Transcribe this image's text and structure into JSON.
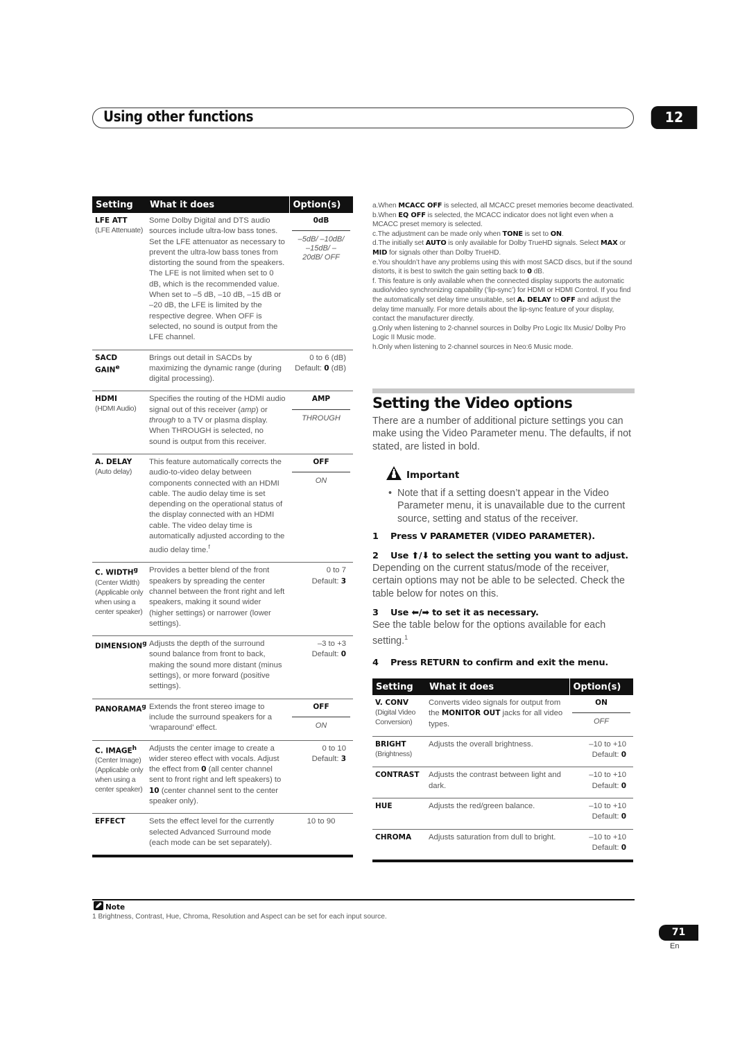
{
  "header": {
    "title": "Using other functions",
    "chapter": "12"
  },
  "audio_table": {
    "columns": [
      "Setting",
      "What it does",
      "Option(s)"
    ],
    "rows": [
      {
        "name": "LFE ATT",
        "sup": "",
        "sub": "(LFE Attenuate)",
        "desc": "Some Dolby Digital and DTS audio sources include ultra-low bass tones. Set the LFE attenuator as necessary to prevent the ultra-low bass tones from distorting the sound from the speakers. The LFE is not limited when set to 0 dB, which is the recommended value. When set to –5 dB, –10 dB, –15 dB or –20 dB, the LFE is limited by the respective degree. When OFF is selected, no sound is output from the LFE channel.",
        "opt_default": "0dB",
        "opt_alt": "–5dB/ –10dB/ –15dB/ –20dB/ OFF"
      },
      {
        "name": "SACD GAIN",
        "sup": "e",
        "sub": "",
        "desc": "Brings out detail in SACDs by maximizing the dynamic range (during digital processing).",
        "range": "0 to 6 (dB)",
        "default_prefix": "Default: ",
        "default_value": "0",
        "default_suffix": " (dB)"
      },
      {
        "name": "HDMI",
        "sup": "",
        "sub": "(HDMI Audio)",
        "desc_parts": [
          "Specifies the routing of the HDMI audio signal out of this receiver (",
          "amp",
          ") or ",
          "through",
          " to a TV or plasma display. When THROUGH is selected, no sound is output from this receiver."
        ],
        "opt_default": "AMP",
        "opt_alt": "THROUGH"
      },
      {
        "name": "A. DELAY",
        "sup": "",
        "sub": "(Auto delay)",
        "desc": "This feature automatically corrects the audio-to-video delay between components connected with an HDMI cable. The audio delay time is set depending on the operational status of the display connected with an HDMI cable. The video delay time is automatically adjusted according to the audio delay time.",
        "desc_sup": "f",
        "opt_default": "OFF",
        "opt_alt": "ON"
      },
      {
        "name": "C. WIDTH",
        "sup": "g",
        "sub": "(Center Width) (Applicable only when using a center speaker)",
        "desc": "Provides a better blend of the front speakers by spreading the center channel between the front right and left speakers, making it sound wider (higher settings) or narrower (lower settings).",
        "range": "0 to 7",
        "default_prefix": "Default: ",
        "default_value": "3",
        "default_suffix": ""
      },
      {
        "name": "DIMENSION",
        "sup": "g",
        "sub": "",
        "desc": "Adjusts the depth of the surround sound balance from front to back, making the sound more distant (minus settings), or more forward (positive settings).",
        "range": "–3 to +3",
        "default_prefix": "Default: ",
        "default_value": "0",
        "default_suffix": ""
      },
      {
        "name": "PANORAMA",
        "sup": "g",
        "sub": "",
        "desc": "Extends the front stereo image to include the surround speakers for a ‘wraparound’ effect.",
        "opt_default": "OFF",
        "opt_alt": "ON"
      },
      {
        "name": "C. IMAGE",
        "sup": "h",
        "sub": "(Center Image) (Applicable only when using a center speaker)",
        "desc_parts": [
          "Adjusts the center image to create a wider stereo effect with vocals. Adjust the effect from ",
          "0",
          " (all center channel sent to front right and left speakers) to ",
          "10",
          " (center channel sent to the center speaker only)."
        ],
        "range": "0 to 10",
        "default_prefix": "Default: ",
        "default_value": "3",
        "default_suffix": ""
      },
      {
        "name": "EFFECT",
        "sup": "",
        "sub": "",
        "desc": "Sets the effect level for the currently selected Advanced Surround mode (each mode can be set separately).",
        "range": "10 to 90"
      }
    ]
  },
  "footnotes": [
    {
      "parts": [
        "a.When ",
        "MCACC OFF",
        " is selected, all MCACC preset memories become deactivated."
      ]
    },
    {
      "parts": [
        "b.When ",
        "EQ OFF",
        " is selected, the MCACC indicator does not light even when a MCACC preset memory is selected."
      ]
    },
    {
      "parts": [
        "c.The adjustment can be made only when ",
        "TONE",
        " is set to ",
        "ON",
        "."
      ]
    },
    {
      "parts": [
        "d.The initially set ",
        "AUTO",
        " is only available for Dolby TrueHD signals. Select ",
        "MAX",
        " or ",
        "MID",
        " for signals other than Dolby TrueHD."
      ]
    },
    {
      "parts": [
        "e.You shouldn’t have any problems using this with most SACD discs, but if the sound distorts, it is best to switch the gain setting back to ",
        "0",
        " dB."
      ]
    },
    {
      "parts": [
        "f. This feature is only available when the connected display supports the automatic audio/video synchronizing capability (‘lip-sync’) for HDMI or HDMI Control. If you find the automatically set delay time unsuitable, set ",
        "A. DELAY",
        " to ",
        "OFF",
        " and adjust the delay time manually. For more details about the lip-sync feature of your display, contact the manufacturer directly."
      ]
    },
    {
      "parts": [
        "g.Only when listening to 2-channel sources in Dolby Pro Logic IIx Music/ Dolby Pro Logic II Music mode."
      ]
    },
    {
      "parts": [
        "h.Only when listening to 2-channel sources in Neo:6 Music mode."
      ]
    }
  ],
  "video_section": {
    "title": "Setting the Video options",
    "intro": "There are a number of additional picture settings you can make using the Video Parameter menu. The defaults, if not stated, are listed in bold.",
    "important_label": "Important",
    "important_bullet": "Note that if a setting doesn’t appear in the Video Parameter menu, it is unavailable due to the current source, setting and status of the receiver.",
    "steps": [
      {
        "num": "1",
        "head": "Press V PARAMETER (VIDEO PARAMETER).",
        "body": ""
      },
      {
        "num": "2",
        "head": "Use ⬆/⬇ to select the setting you want to adjust.",
        "body": "Depending on the current status/mode of the receiver, certain options may not be able to be selected. Check the table below for notes on this."
      },
      {
        "num": "3",
        "head": "Use ⬅/➡ to set it as necessary.",
        "body": "See the table below for the options available for each setting.",
        "body_sup": "1"
      },
      {
        "num": "4",
        "head": "Press RETURN to confirm and exit the menu.",
        "body": ""
      }
    ]
  },
  "video_table": {
    "columns": [
      "Setting",
      "What it does",
      "Option(s)"
    ],
    "rows": [
      {
        "name": "V. CONV",
        "sub": "(Digital Video Conversion)",
        "desc_parts": [
          "Converts video signals for output from the ",
          "MONITOR OUT",
          " jacks for all video types."
        ],
        "opt_default": "ON",
        "opt_alt": "OFF"
      },
      {
        "name": "BRIGHT",
        "sub": "(Brightness)",
        "desc": "Adjusts the overall brightness.",
        "range": "–10 to +10",
        "default_prefix": "Default: ",
        "default_value": "0"
      },
      {
        "name": "CONTRAST",
        "sub": "",
        "desc": "Adjusts the contrast between light and dark.",
        "range": "–10 to +10",
        "default_prefix": "Default: ",
        "default_value": "0"
      },
      {
        "name": "HUE",
        "sub": "",
        "desc": "Adjusts the red/green balance.",
        "range": "–10 to +10",
        "default_prefix": "Default: ",
        "default_value": "0"
      },
      {
        "name": "CHROMA",
        "sub": "",
        "desc": "Adjusts saturation from dull to bright.",
        "range": "–10 to +10",
        "default_prefix": "Default: ",
        "default_value": "0"
      }
    ]
  },
  "note": {
    "label": "Note",
    "text": "1 Brightness, Contrast, Hue, Chroma, Resolution and Aspect can be set for each input source."
  },
  "footer": {
    "page_number": "71",
    "language": "En"
  }
}
